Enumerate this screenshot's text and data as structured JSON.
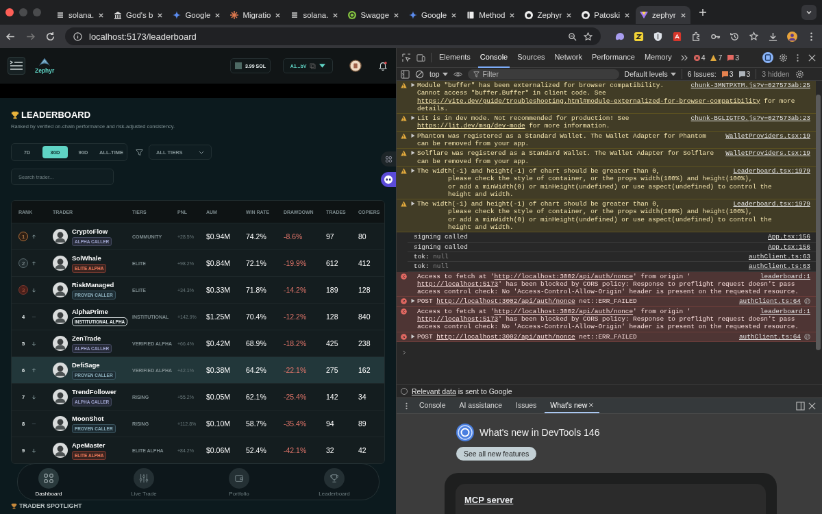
{
  "browser": {
    "tabs": [
      {
        "title": "solana.",
        "selected": false
      },
      {
        "title": "God's b",
        "selected": false
      },
      {
        "title": "Google",
        "selected": false
      },
      {
        "title": "Migratio",
        "selected": false
      },
      {
        "title": "solana.",
        "selected": false
      },
      {
        "title": "Swagge",
        "selected": false
      },
      {
        "title": "Google",
        "selected": false
      },
      {
        "title": "Method",
        "selected": false
      },
      {
        "title": "Zephyr",
        "selected": false
      },
      {
        "title": "Patoski",
        "selected": false
      },
      {
        "title": "zephyr",
        "selected": true
      }
    ],
    "url": "localhost:5173/leaderboard"
  },
  "app": {
    "header": {
      "brand": "Zephyr",
      "balance": "3.99 SOL",
      "wallet": "A1...bV"
    },
    "title": "LEADERBOARD",
    "subtitle": "Ranked by verified on-chain performance and risk-adjusted consistency.",
    "periods": [
      {
        "label": "7D",
        "selected": false
      },
      {
        "label": "30D",
        "selected": true
      },
      {
        "label": "90D",
        "selected": false
      },
      {
        "label": "ALL-TIME",
        "selected": false
      }
    ],
    "tier_filter": "ALL TIERS",
    "search": {
      "placeholder": "Search trader..."
    },
    "table": {
      "columns": [
        "RANK",
        "TRADER",
        "TIERS",
        "PNL",
        "AUM",
        "WIN RATE",
        "DRAWDOWN",
        "TRADES",
        "COPIERS"
      ],
      "rows": [
        {
          "rank": {
            "text": "1",
            "kind": "gold"
          },
          "trend": {
            "kind": "up"
          },
          "name": "CryptoFlow",
          "badge": {
            "label": "ALPHA CALLER",
            "kind": "alpha"
          },
          "tier": "COMMUNITY",
          "pnl": "+28.5%",
          "aum": "$0.94M",
          "win_rate": "74.2%",
          "drawdown": "-8.6%",
          "trades": "97",
          "copiers": "80",
          "selected": false
        },
        {
          "rank": {
            "text": "2",
            "kind": "silver"
          },
          "trend": {
            "kind": "up"
          },
          "name": "SolWhale",
          "badge": {
            "label": "ELITE ALPHA",
            "kind": "elite"
          },
          "tier": "ELITE",
          "pnl": "+98.2%",
          "aum": "$0.84M",
          "win_rate": "72.1%",
          "drawdown": "-19.9%",
          "trades": "612",
          "copiers": "412",
          "selected": false
        },
        {
          "rank": {
            "text": "3",
            "kind": "bronze"
          },
          "trend": {
            "kind": "down"
          },
          "name": "RiskManaged",
          "badge": {
            "label": "PROVEN CALLER",
            "kind": "proven"
          },
          "tier": "ELITE",
          "pnl": "+34.3%",
          "aum": "$0.33M",
          "win_rate": "71.8%",
          "drawdown": "-14.2%",
          "trades": "189",
          "copiers": "128",
          "selected": false
        },
        {
          "rank": {
            "text": "4",
            "kind": "plain"
          },
          "trend": {
            "kind": "flat"
          },
          "name": "AlphaPrime",
          "badge": {
            "label": "INSTITUTIONAL ALPHA",
            "kind": "institutional"
          },
          "tier": "INSTITUTIONAL",
          "pnl": "+142.9%",
          "aum": "$1.25M",
          "win_rate": "70.4%",
          "drawdown": "-12.2%",
          "trades": "128",
          "copiers": "840",
          "selected": false
        },
        {
          "rank": {
            "text": "5",
            "kind": "plain"
          },
          "trend": {
            "kind": "down"
          },
          "name": "ZenTrade",
          "badge": {
            "label": "ALPHA CALLER",
            "kind": "alpha"
          },
          "tier": "VERIFIED ALPHA",
          "pnl": "+66.4%",
          "aum": "$0.42M",
          "win_rate": "68.9%",
          "drawdown": "-18.2%",
          "trades": "425",
          "copiers": "238",
          "selected": false
        },
        {
          "rank": {
            "text": "6",
            "kind": "plain"
          },
          "trend": {
            "kind": "up"
          },
          "name": "DefiSage",
          "badge": {
            "label": "PROVEN CALLER",
            "kind": "proven"
          },
          "tier": "VERIFIED ALPHA",
          "pnl": "+42.1%",
          "aum": "$0.38M",
          "win_rate": "64.2%",
          "drawdown": "-22.1%",
          "trades": "275",
          "copiers": "162",
          "selected": true
        },
        {
          "rank": {
            "text": "7",
            "kind": "plain"
          },
          "trend": {
            "kind": "down"
          },
          "name": "TrendFollower",
          "badge": {
            "label": "ALPHA CALLER",
            "kind": "alpha"
          },
          "tier": "RISING",
          "pnl": "+55.2%",
          "aum": "$0.05M",
          "win_rate": "62.1%",
          "drawdown": "-25.4%",
          "trades": "142",
          "copiers": "34",
          "selected": false
        },
        {
          "rank": {
            "text": "8",
            "kind": "plain"
          },
          "trend": {
            "kind": "flat"
          },
          "name": "MoonShot",
          "badge": {
            "label": "PROVEN CALLER",
            "kind": "proven"
          },
          "tier": "RISING",
          "pnl": "+112.8%",
          "aum": "$0.10M",
          "win_rate": "58.7%",
          "drawdown": "-35.4%",
          "trades": "94",
          "copiers": "89",
          "selected": false
        },
        {
          "rank": {
            "text": "9",
            "kind": "plain"
          },
          "trend": {
            "kind": "down"
          },
          "name": "ApeMaster",
          "badge": {
            "label": "ELITE ALPHA",
            "kind": "elite"
          },
          "tier": "ELITE ALPHA",
          "pnl": "+84.2%",
          "aum": "$0.06M",
          "win_rate": "52.4%",
          "drawdown": "-42.1%",
          "trades": "32",
          "copiers": "42",
          "selected": false
        }
      ]
    },
    "nav": [
      {
        "label": "Dashboard",
        "selected": true
      },
      {
        "label": "Live Trade",
        "selected": false
      },
      {
        "label": "Portfolio",
        "selected": false
      },
      {
        "label": "Leaderboard",
        "selected": false
      }
    ],
    "spotlight": "TRADER SPOTLIGHT"
  },
  "devtools": {
    "tabs": [
      {
        "label": "Elements",
        "selected": false
      },
      {
        "label": "Console",
        "selected": true
      },
      {
        "label": "Sources",
        "selected": false
      },
      {
        "label": "Network",
        "selected": false
      },
      {
        "label": "Performance",
        "selected": false
      },
      {
        "label": "Memory",
        "selected": false
      }
    ],
    "counts": {
      "errors": "4",
      "warnings": "7",
      "messages": "3"
    },
    "context": "top",
    "filter": {
      "placeholder": "Filter"
    },
    "levels": "Default levels",
    "issues": {
      "label": "6 Issues:",
      "counts": [
        {
          "count": "3",
          "kind": "warning"
        },
        {
          "count": "3",
          "kind": "info"
        }
      ]
    },
    "hidden": "3 hidden",
    "messages": [
      {
        "kind": "warning",
        "expandable": true,
        "source": "chunk-3MNTPXTM.js?v=027573ab:25",
        "lines": [
          [
            {
              "kind": "plain",
              "text": "Module \"buffer\" has been externalized for browser compatibility."
            }
          ],
          [
            {
              "kind": "plain",
              "text": "Cannot access \"buffer.Buffer\" in client code. See"
            }
          ],
          [
            {
              "kind": "link",
              "text": "https://vite.dev/guide/troubleshooting.html#module-externalized-for-browser-compatibility"
            },
            {
              "kind": "plain",
              "text": " for more"
            }
          ],
          [
            {
              "kind": "plain",
              "text": "details."
            }
          ]
        ]
      },
      {
        "kind": "warning",
        "expandable": true,
        "source": "chunk-BGLIGTFO.js?v=027573ab:23",
        "lines": [
          [
            {
              "kind": "plain",
              "text": "Lit is in dev mode. Not recommended for production! See"
            }
          ],
          [
            {
              "kind": "link",
              "text": "https://lit.dev/msg/dev-mode"
            },
            {
              "kind": "plain",
              "text": " for more information."
            }
          ]
        ]
      },
      {
        "kind": "warning",
        "expandable": true,
        "source": "WalletProviders.tsx:19",
        "lines": [
          [
            {
              "kind": "plain",
              "text": "Phantom was registered as a Standard Wallet. The Wallet Adapter for Phantom"
            }
          ],
          [
            {
              "kind": "plain",
              "text": "can be removed from your app."
            }
          ]
        ]
      },
      {
        "kind": "warning",
        "expandable": true,
        "source": "WalletProviders.tsx:19",
        "lines": [
          [
            {
              "kind": "plain",
              "text": "Solflare was registered as a Standard Wallet. The Wallet Adapter for Solflare"
            }
          ],
          [
            {
              "kind": "plain",
              "text": "can be removed from your app."
            }
          ]
        ]
      },
      {
        "kind": "warning",
        "expandable": true,
        "source": "Leaderboard.tsx:1979",
        "lines": [
          [
            {
              "kind": "plain",
              "text": "The width(-1) and height(-1) of chart should be greater than 0,"
            }
          ],
          [
            {
              "kind": "plain",
              "text": "        please check the style of container, or the props width(100%) and height(100%),"
            }
          ],
          [
            {
              "kind": "plain",
              "text": "        or add a minWidth(0) or minHeight(undefined) or use aspect(undefined) to control the"
            }
          ],
          [
            {
              "kind": "plain",
              "text": "        height and width."
            }
          ]
        ]
      },
      {
        "kind": "warning",
        "expandable": true,
        "source": "Leaderboard.tsx:1979",
        "lines": [
          [
            {
              "kind": "plain",
              "text": "The width(-1) and height(-1) of chart should be greater than 0,"
            }
          ],
          [
            {
              "kind": "plain",
              "text": "        please check the style of container, or the props width(100%) and height(100%),"
            }
          ],
          [
            {
              "kind": "plain",
              "text": "        or add a minWidth(0) or minHeight(undefined) or use aspect(undefined) to control the"
            }
          ],
          [
            {
              "kind": "plain",
              "text": "        height and width."
            }
          ]
        ]
      },
      {
        "kind": "log",
        "expandable": false,
        "source": "App.tsx:156",
        "lines": [
          [
            {
              "kind": "plain",
              "text": "signing called"
            }
          ]
        ]
      },
      {
        "kind": "log",
        "expandable": false,
        "source": "App.tsx:156",
        "lines": [
          [
            {
              "kind": "plain",
              "text": "signing called"
            }
          ]
        ]
      },
      {
        "kind": "log",
        "expandable": false,
        "source": "authClient.ts:63",
        "lines": [
          [
            {
              "kind": "plain",
              "text": "tok: "
            },
            {
              "kind": "muted",
              "text": "null"
            }
          ]
        ]
      },
      {
        "kind": "log",
        "expandable": false,
        "source": "authClient.ts:63",
        "lines": [
          [
            {
              "kind": "plain",
              "text": "tok: "
            },
            {
              "kind": "muted",
              "text": "null"
            }
          ]
        ]
      },
      {
        "kind": "error",
        "expandable": false,
        "source": "leaderboard:1",
        "lines": [
          [
            {
              "kind": "plain",
              "text": "Access to fetch at '"
            },
            {
              "kind": "link",
              "text": "http://localhost:3002/api/auth/nonce"
            },
            {
              "kind": "plain",
              "text": "' from origin '"
            }
          ],
          [
            {
              "kind": "link",
              "text": "http://localhost:5173"
            },
            {
              "kind": "plain",
              "text": "' has been blocked by CORS policy: Response to preflight request doesn't pass"
            }
          ],
          [
            {
              "kind": "plain",
              "text": "access control check: No 'Access-Control-Allow-Origin' header is present on the requested resource."
            }
          ]
        ]
      },
      {
        "kind": "error",
        "expandable": true,
        "network": true,
        "source": "authClient.ts:64",
        "lines": [
          [
            {
              "kind": "plain",
              "text": "POST "
            },
            {
              "kind": "link",
              "text": "http://localhost:3002/api/auth/nonce"
            },
            {
              "kind": "plain",
              "text": " net::ERR_FAILED"
            }
          ]
        ]
      },
      {
        "kind": "error",
        "expandable": false,
        "source": "leaderboard:1",
        "lines": [
          [
            {
              "kind": "plain",
              "text": "Access to fetch at '"
            },
            {
              "kind": "link",
              "text": "http://localhost:3002/api/auth/nonce"
            },
            {
              "kind": "plain",
              "text": "' from origin '"
            }
          ],
          [
            {
              "kind": "link",
              "text": "http://localhost:5173"
            },
            {
              "kind": "plain",
              "text": "' has been blocked by CORS policy: Response to preflight request doesn't pass"
            }
          ],
          [
            {
              "kind": "plain",
              "text": "access control check: No 'Access-Control-Allow-Origin' header is present on the requested resource."
            }
          ]
        ]
      },
      {
        "kind": "error",
        "expandable": true,
        "network": true,
        "source": "authClient.ts:64",
        "lines": [
          [
            {
              "kind": "plain",
              "text": "POST "
            },
            {
              "kind": "link",
              "text": "http://localhost:3002/api/auth/nonce"
            },
            {
              "kind": "plain",
              "text": " net::ERR_FAILED"
            }
          ]
        ]
      }
    ],
    "consent": {
      "checked": false,
      "link": "Relevant data",
      "text": " is sent to Google"
    },
    "drawer": {
      "tabs": [
        {
          "label": "Console",
          "selected": false,
          "closable": false
        },
        {
          "label": "AI assistance",
          "selected": false,
          "closable": false
        },
        {
          "label": "Issues",
          "selected": false,
          "closable": false
        },
        {
          "label": "What's new",
          "selected": true,
          "closable": true
        }
      ],
      "title": "What's new in DevTools 146",
      "button": "See all new features",
      "card_title": "MCP server"
    }
  }
}
